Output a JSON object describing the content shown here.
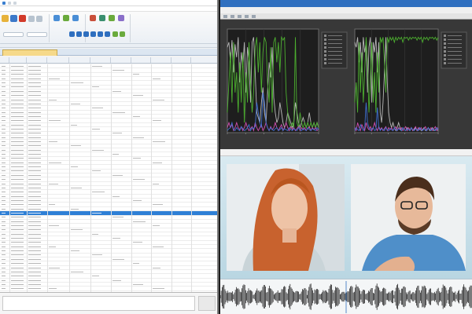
{
  "left_window": {
    "title": "",
    "menu_items": [
      "",
      "",
      "",
      "",
      "",
      "",
      ""
    ],
    "tab_label": "",
    "column_headers": [
      "",
      "",
      "",
      "",
      "",
      "",
      "",
      "",
      "",
      "",
      ""
    ],
    "selected_row_index": 35
  },
  "chart_window": {
    "title": "",
    "menu_items": [
      "",
      "",
      "",
      "",
      ""
    ]
  },
  "video_window": {
    "title": ""
  },
  "colors": {
    "ribbon_blue": "#2f6fbf",
    "selection": "#2e7fd6",
    "signal_green": "#4caf2f",
    "signal_grey": "#b8b8b8",
    "signal_pink": "#d24fb2",
    "signal_blue": "#3f6fd0",
    "plot_background": "#1e1e1e"
  },
  "chart_data": [
    {
      "type": "line",
      "title": "",
      "xlabel": "",
      "ylabel": "",
      "x": [
        0,
        1,
        2,
        3,
        4,
        5,
        6,
        7,
        8,
        9,
        10,
        11,
        12,
        13,
        14,
        15,
        16,
        17,
        18,
        19,
        20,
        21,
        22,
        23,
        24,
        25,
        26,
        27,
        28,
        29,
        30,
        31,
        32,
        33,
        34,
        35,
        36,
        37,
        38,
        39,
        40,
        41,
        42,
        43,
        44,
        45,
        46,
        47,
        48,
        49,
        50,
        51,
        52,
        53,
        54,
        55,
        56,
        57,
        58,
        59
      ],
      "series": [
        {
          "values": [
            0.85,
            0.9,
            0.7,
            0.92,
            0.6,
            0.88,
            0.75,
            0.95,
            0.5,
            0.8,
            0.65,
            0.9,
            0.4,
            0.85,
            0.7,
            0.3,
            0.9,
            0.95,
            0.6,
            0.2,
            0.15,
            0.1,
            0.3,
            0.45,
            0.2,
            0.1,
            0.4,
            0.7,
            0.55,
            0.85,
            0.35,
            0.2,
            0.1,
            0.15,
            0.3,
            0.2,
            0.1,
            0.05,
            0.1,
            0.2,
            0.15,
            0.1,
            0.05,
            0.1,
            0.3,
            0.2,
            0.1,
            0.05,
            0.1,
            0.15,
            0.1,
            0.05,
            0.1,
            0.2,
            0.1,
            0.05,
            0.1,
            0.05,
            0.1,
            0.05
          ]
        },
        {
          "values": [
            0.2,
            0.5,
            0.8,
            0.3,
            0.9,
            0.4,
            0.6,
            0.2,
            0.7,
            0.3,
            0.8,
            0.1,
            0.6,
            0.3,
            0.9,
            0.5,
            0.2,
            0.4,
            0.85,
            0.95,
            0.6,
            0.9,
            0.4,
            0.8,
            0.95,
            0.9,
            0.5,
            0.3,
            0.85,
            0.2,
            0.9,
            0.95,
            0.7,
            0.9,
            0.6,
            0.95,
            0.92,
            0.95,
            0.4,
            0.2,
            0.1,
            0.05,
            0.1,
            0.05,
            0.95,
            0.1,
            0.05,
            0.2,
            0.1,
            0.05,
            0.1,
            0.05,
            0.1,
            0.05,
            0.1,
            0.05,
            0.1,
            0.05,
            0.1,
            0.05
          ]
        },
        {
          "values": [
            0.05,
            0.1,
            0.05,
            0.08,
            0.02,
            0.05,
            0.1,
            0.05,
            0.03,
            0.06,
            0.02,
            0.05,
            0.1,
            0.05,
            0.02,
            0.04,
            0.06,
            0.02,
            0.1,
            0.05,
            0.02,
            0.05,
            0.08,
            0.02,
            0.05,
            0.1,
            0.05,
            0.02,
            0.06,
            0.03,
            0.05,
            0.1,
            0.05,
            0.02,
            0.05,
            0.08,
            0.02,
            0.05,
            0.1,
            0.05,
            0.02,
            0.06,
            0.03,
            0.05,
            0.02,
            0.04,
            0.06,
            0.02,
            0.05,
            0.03,
            0.05,
            0.02,
            0.04,
            0.06,
            0.02,
            0.05,
            0.03,
            0.05,
            0.02,
            0.04
          ]
        },
        {
          "values": [
            0.02,
            0.04,
            0.05,
            0.1,
            0.03,
            0.02,
            0.05,
            0.03,
            0.02,
            0.06,
            0.04,
            0.02,
            0.03,
            0.05,
            0.08,
            0.02,
            0.05,
            0.04,
            0.06,
            0.3,
            0.2,
            0.1,
            0.05,
            0.4,
            0.3,
            0.1,
            0.05,
            0.02,
            0.05,
            0.03,
            0.02,
            0.04,
            0.05,
            0.02,
            0.03,
            0.05,
            0.02,
            0.04,
            0.03,
            0.02,
            0.05,
            0.03,
            0.02,
            0.04,
            0.03,
            0.02,
            0.05,
            0.03,
            0.02,
            0.04,
            0.03,
            0.02,
            0.05,
            0.03,
            0.02,
            0.04,
            0.03,
            0.02,
            0.05,
            0.03
          ]
        }
      ]
    },
    {
      "type": "line",
      "title": "",
      "xlabel": "",
      "ylabel": "",
      "x": [
        0,
        1,
        2,
        3,
        4,
        5,
        6,
        7,
        8,
        9,
        10,
        11,
        12,
        13,
        14,
        15,
        16,
        17,
        18,
        19,
        20,
        21,
        22,
        23,
        24,
        25,
        26,
        27,
        28,
        29,
        30,
        31,
        32,
        33,
        34,
        35,
        36,
        37,
        38,
        39,
        40,
        41,
        42,
        43,
        44,
        45,
        46,
        47,
        48,
        49,
        50,
        51,
        52,
        53,
        54,
        55,
        56,
        57,
        58,
        59
      ],
      "series": [
        {
          "values": [
            0.9,
            0.85,
            0.95,
            0.7,
            0.9,
            0.6,
            0.95,
            0.8,
            0.9,
            0.4,
            0.85,
            0.95,
            0.3,
            0.9,
            0.8,
            0.95,
            0.6,
            0.9,
            0.2,
            0.1,
            0.3,
            0.6,
            0.95,
            0.5,
            0.2,
            0.1,
            0.05,
            0.1,
            0.05,
            0.02,
            0.05,
            0.1,
            0.05,
            0.02,
            0.05,
            0.03,
            0.02,
            0.05,
            0.03,
            0.02,
            0.05,
            0.02,
            0.03,
            0.05,
            0.02,
            0.03,
            0.05,
            0.02,
            0.03,
            0.05,
            0.02,
            0.03,
            0.05,
            0.02,
            0.03,
            0.05,
            0.02,
            0.03,
            0.05,
            0.02
          ]
        },
        {
          "values": [
            0.3,
            0.5,
            0.2,
            0.9,
            0.4,
            0.8,
            0.3,
            0.6,
            0.95,
            0.7,
            0.2,
            0.5,
            0.9,
            0.3,
            0.6,
            0.2,
            0.8,
            0.4,
            0.95,
            0.9,
            0.95,
            0.7,
            0.4,
            0.95,
            0.9,
            0.95,
            0.92,
            0.95,
            0.9,
            0.95,
            0.92,
            0.95,
            0.93,
            0.95,
            0.9,
            0.95,
            0.94,
            0.95,
            0.92,
            0.95,
            0.93,
            0.95,
            0.94,
            0.95,
            0.92,
            0.95,
            0.93,
            0.95,
            0.9,
            0.95,
            0.93,
            0.95,
            0.92,
            0.95,
            0.94,
            0.95,
            0.93,
            0.95,
            0.92,
            0.95
          ]
        },
        {
          "values": [
            0.05,
            0.02,
            0.1,
            0.05,
            0.02,
            0.08,
            0.05,
            0.02,
            0.1,
            0.05,
            0.03,
            0.06,
            0.02,
            0.05,
            0.1,
            0.05,
            0.02,
            0.06,
            0.03,
            0.05,
            0.02,
            0.04,
            0.06,
            0.02,
            0.05,
            0.03,
            0.05,
            0.02,
            0.04,
            0.06,
            0.02,
            0.05,
            0.03,
            0.05,
            0.02,
            0.04,
            0.06,
            0.02,
            0.05,
            0.03,
            0.05,
            0.02,
            0.04,
            0.06,
            0.02,
            0.05,
            0.03,
            0.05,
            0.02,
            0.04,
            0.06,
            0.02,
            0.05,
            0.03,
            0.05,
            0.02,
            0.04,
            0.06,
            0.02,
            0.05
          ]
        },
        {
          "values": [
            0.02,
            0.05,
            0.03,
            0.02,
            0.08,
            0.05,
            0.02,
            0.04,
            0.3,
            0.1,
            0.05,
            0.02,
            0.04,
            0.05,
            0.02,
            0.03,
            0.25,
            0.05,
            0.02,
            0.04,
            0.03,
            0.02,
            0.05,
            0.03,
            0.02,
            0.04,
            0.03,
            0.02,
            0.05,
            0.03,
            0.02,
            0.04,
            0.03,
            0.02,
            0.05,
            0.03,
            0.02,
            0.04,
            0.03,
            0.02,
            0.05,
            0.03,
            0.02,
            0.04,
            0.03,
            0.02,
            0.05,
            0.03,
            0.02,
            0.04,
            0.03,
            0.02,
            0.05,
            0.03,
            0.02,
            0.04,
            0.03,
            0.02,
            0.05,
            0.03
          ]
        }
      ]
    }
  ]
}
